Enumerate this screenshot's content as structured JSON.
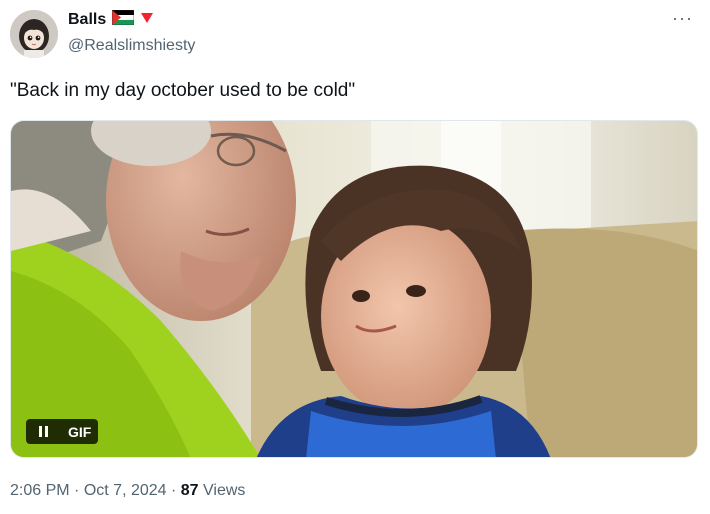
{
  "author": {
    "display_name": "Balls",
    "handle": "@Realslimshiesty",
    "flag_icon": "palestine-flag-icon",
    "badge_icon": "red-heart-triangle-icon"
  },
  "menu": {
    "more_icon": "more-horizontal-icon",
    "label": "···"
  },
  "tweet": {
    "text": "\"Back in my day october used to be cold\""
  },
  "media": {
    "type": "gif",
    "badge_label": "GIF",
    "pause_icon": "pause-icon"
  },
  "meta": {
    "time": "2:06 PM",
    "separator": "·",
    "date": "Oct 7, 2024",
    "views_count": "87",
    "views_label": "Views"
  },
  "colors": {
    "text": "#0f1419",
    "secondary": "#536471",
    "badge": "#f4212e"
  }
}
